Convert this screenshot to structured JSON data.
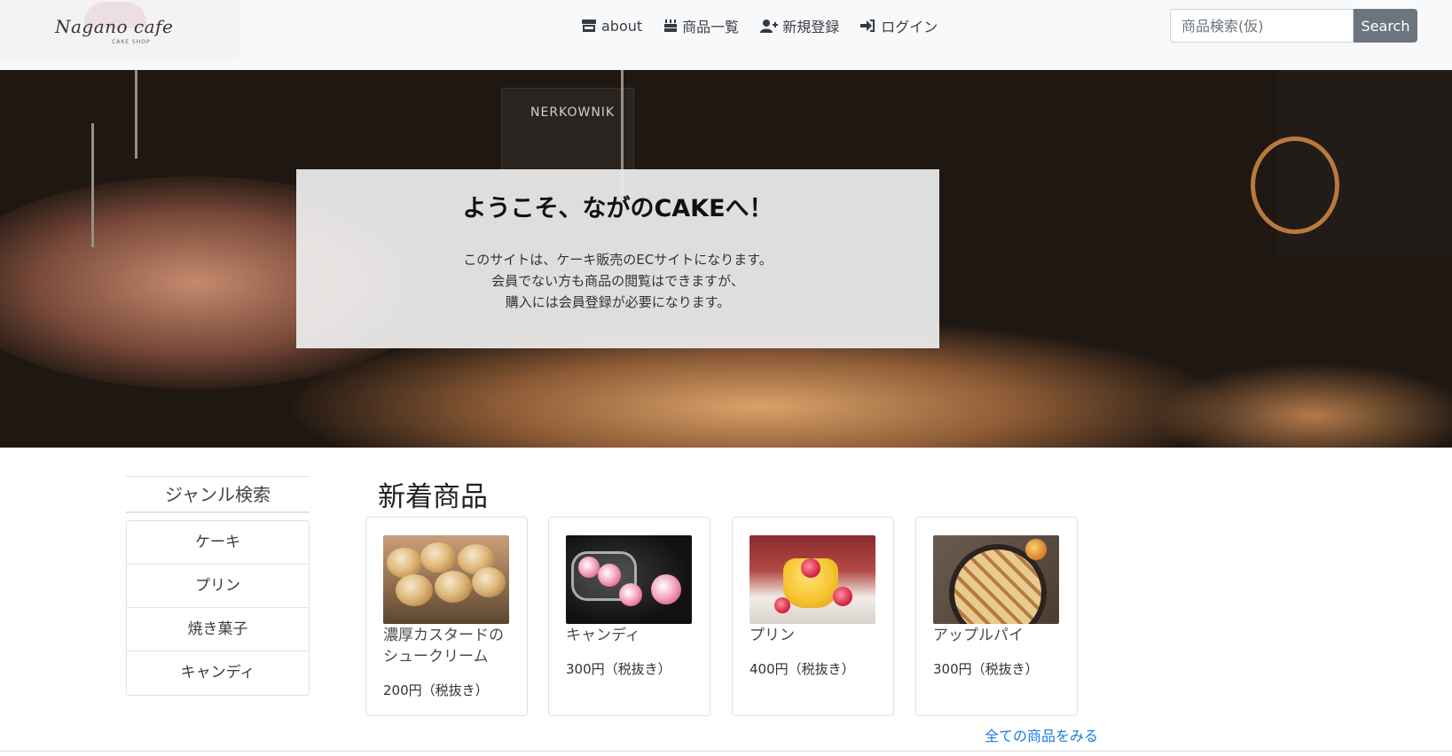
{
  "logo": {
    "script": "Nagano cafe",
    "sub": "CAKE SHOP"
  },
  "nav": {
    "items": [
      {
        "label": "about",
        "icon": "store-icon"
      },
      {
        "label": "商品一覧",
        "icon": "cake-icon"
      },
      {
        "label": "新規登録",
        "icon": "user-plus-icon"
      },
      {
        "label": "ログイン",
        "icon": "sign-in-icon"
      }
    ]
  },
  "search": {
    "placeholder": "商品検索(仮)",
    "value": "",
    "button_label": "Search"
  },
  "hero": {
    "sign_text": "NERKOWNIK",
    "title": "ようこそ、ながのCAKEへ！",
    "lines": [
      "このサイトは、ケーキ販売のECサイトになります。",
      "会員でない方も商品の閲覧はできますが、",
      "購入には会員登録が必要になります。"
    ]
  },
  "genre": {
    "heading": "ジャンル検索",
    "items": [
      "ケーキ",
      "プリン",
      "焼き菓子",
      "キャンディ"
    ]
  },
  "new_items": {
    "heading": "新着商品",
    "products": [
      {
        "name_line1": "濃厚カスタードの",
        "name_line2": "シュークリーム",
        "price": "200円（税抜き）"
      },
      {
        "name_line1": "キャンディ",
        "name_line2": "",
        "price": "300円（税抜き）"
      },
      {
        "name_line1": "プリン",
        "name_line2": "",
        "price": "400円（税抜き）"
      },
      {
        "name_line1": "アップルパイ",
        "name_line2": "",
        "price": "300円（税抜き）"
      }
    ],
    "all_link": "全ての商品をみる"
  }
}
